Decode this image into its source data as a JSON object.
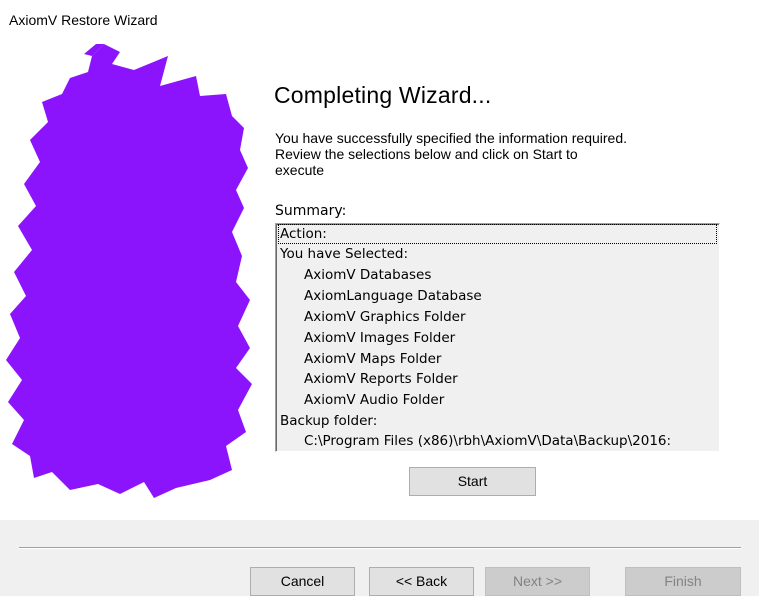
{
  "window": {
    "title": "AxiomV Restore Wizard"
  },
  "wizard": {
    "heading": "Completing Wizard...",
    "intro_lines": [
      "You have successfully specified the information required.",
      "Review the selections below and click on Start to",
      "execute"
    ],
    "summary_label": "Summary:",
    "summary_items": [
      "Action:",
      "You have Selected:",
      "AxiomV Databases",
      "AxiomLanguage Database",
      "AxiomV Graphics Folder",
      "AxiomV Images Folder",
      "AxiomV Maps Folder",
      "AxiomV Reports Folder",
      "AxiomV Audio Folder",
      "Backup folder:",
      "C:\\Program Files (x86)\\rbh\\AxiomV\\Data\\Backup\\2016:"
    ],
    "start_label": "Start"
  },
  "footer": {
    "cancel_label": "Cancel",
    "back_label": "<< Back",
    "next_label": "Next >>",
    "finish_label": "Finish"
  },
  "colors": {
    "art_purple": "#8c14fc",
    "panel_gray": "#f0f0f0",
    "button_face": "#e1e1e1",
    "disabled_text": "#838383"
  }
}
